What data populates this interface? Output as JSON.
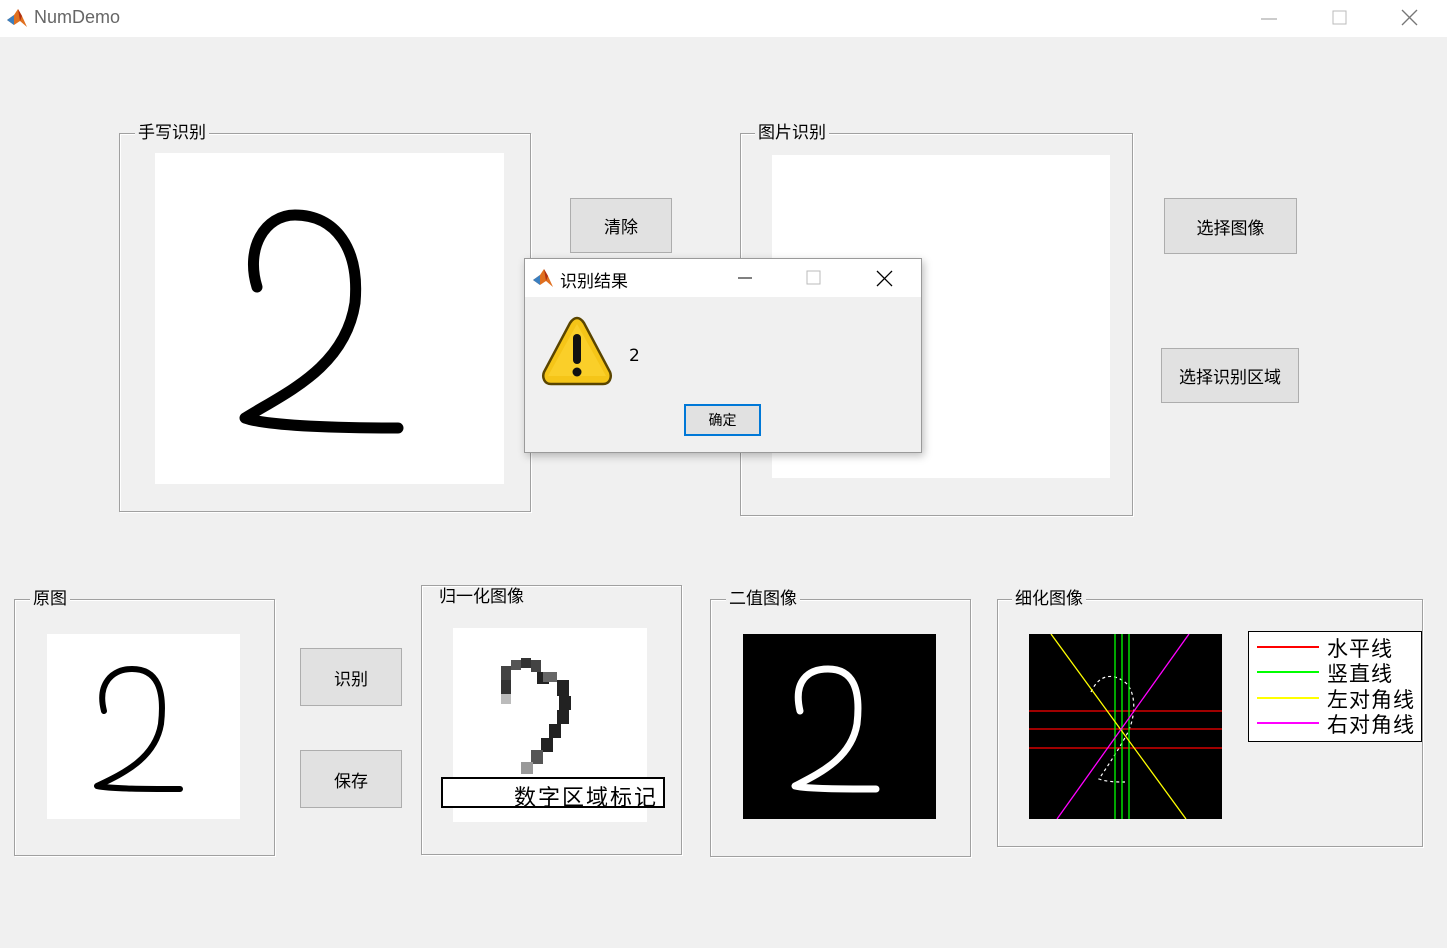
{
  "window": {
    "title": "NumDemo",
    "icon": "matlab-icon",
    "controls": [
      "minimize-icon",
      "maximize-icon",
      "close-icon"
    ]
  },
  "panels": {
    "handwriting": {
      "title": "手写识别"
    },
    "image_recognition": {
      "title": "图片识别"
    },
    "original": {
      "title": "原图"
    },
    "normalized": {
      "title": "归一化图像",
      "overlay_label": "数字区域标记"
    },
    "binary": {
      "title": "二值图像"
    },
    "thinned": {
      "title": "细化图像",
      "legend": [
        {
          "label": "水平线",
          "color": "#ff0000"
        },
        {
          "label": "竖直线",
          "color": "#00ff00"
        },
        {
          "label": "左对角线",
          "color": "#ffff00"
        },
        {
          "label": "右对角线",
          "color": "#ff00ff"
        }
      ]
    }
  },
  "buttons": {
    "clear": "清除",
    "select_image": "选择图像",
    "select_region": "选择识别区域",
    "recognize": "识别",
    "save": "保存"
  },
  "dialog": {
    "title": "识别结果",
    "message": "2",
    "ok_label": "确定",
    "icon": "warning-icon"
  },
  "drawn_digit": "2"
}
